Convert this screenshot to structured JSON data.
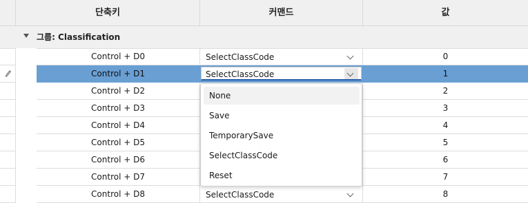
{
  "header": {
    "col_shortcut": "단축키",
    "col_command": "커맨드",
    "col_value": "값"
  },
  "group": {
    "label": "그룹: Classification"
  },
  "rows": [
    {
      "shortcut": "Control + D0",
      "command": "SelectClassCode",
      "value": "0"
    },
    {
      "shortcut": "Control + D1",
      "command": "SelectClassCode",
      "value": "1"
    },
    {
      "shortcut": "Control + D2",
      "command": "",
      "value": "2"
    },
    {
      "shortcut": "Control + D3",
      "command": "",
      "value": "3"
    },
    {
      "shortcut": "Control + D4",
      "command": "",
      "value": "4"
    },
    {
      "shortcut": "Control + D5",
      "command": "",
      "value": "5"
    },
    {
      "shortcut": "Control + D6",
      "command": "",
      "value": "6"
    },
    {
      "shortcut": "Control + D7",
      "command": "",
      "value": "7"
    },
    {
      "shortcut": "Control + D8",
      "command": "SelectClassCode",
      "value": "8"
    }
  ],
  "dropdown": {
    "options": [
      "None",
      "Save",
      "TemporarySave",
      "SelectClassCode",
      "Reset"
    ]
  },
  "colors": {
    "selected_row": "#6a9fd4",
    "focus_underline": "#2a5ea8",
    "header_bg": "#f0f0f0"
  }
}
